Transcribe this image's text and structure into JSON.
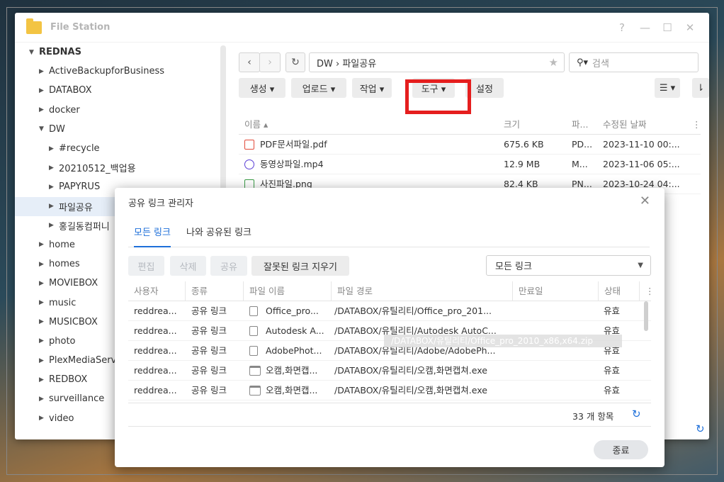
{
  "window": {
    "title": "File Station",
    "controls": [
      "?",
      "—",
      "☐",
      "✕"
    ]
  },
  "sidebar": {
    "root": "REDNAS",
    "items": [
      {
        "label": "ActiveBackupforBusiness",
        "level": 1,
        "expanded": false
      },
      {
        "label": "DATABOX",
        "level": 1,
        "expanded": false
      },
      {
        "label": "docker",
        "level": 1,
        "expanded": false
      },
      {
        "label": "DW",
        "level": 1,
        "expanded": true
      },
      {
        "label": "#recycle",
        "level": 2,
        "expanded": false
      },
      {
        "label": "20210512_백업용",
        "level": 2,
        "expanded": false
      },
      {
        "label": "PAPYRUS",
        "level": 2,
        "expanded": false
      },
      {
        "label": "파일공유",
        "level": 2,
        "expanded": false,
        "selected": true
      },
      {
        "label": "홍길동컴퍼니",
        "level": 2,
        "expanded": false
      },
      {
        "label": "home",
        "level": 1,
        "expanded": false
      },
      {
        "label": "homes",
        "level": 1,
        "expanded": false
      },
      {
        "label": "MOVIEBOX",
        "level": 1,
        "expanded": false
      },
      {
        "label": "music",
        "level": 1,
        "expanded": false
      },
      {
        "label": "MUSICBOX",
        "level": 1,
        "expanded": false
      },
      {
        "label": "photo",
        "level": 1,
        "expanded": false
      },
      {
        "label": "PlexMediaServer",
        "level": 1,
        "expanded": false
      },
      {
        "label": "REDBOX",
        "level": 1,
        "expanded": false
      },
      {
        "label": "surveillance",
        "level": 1,
        "expanded": false
      },
      {
        "label": "video",
        "level": 1,
        "expanded": false
      }
    ]
  },
  "nav": {
    "back": "‹",
    "forward": "›",
    "refresh": "↻",
    "path": "DW › 파일공유",
    "search_placeholder": "검색"
  },
  "toolbar": {
    "create": "생성 ▾",
    "upload": "업로드 ▾",
    "action": "작업 ▾",
    "tools": "도구 ▾",
    "settings": "설정"
  },
  "file_table": {
    "headers": {
      "name": "이름 ▴",
      "size": "크기",
      "type": "파...",
      "modified": "수정된 날짜",
      "more": "⋮"
    },
    "rows": [
      {
        "name": "PDF문서파일.pdf",
        "size": "675.6 KB",
        "type": "PD...",
        "modified": "2023-11-10 00:...",
        "icon": "pdf-icon",
        "color": "#e24b3b"
      },
      {
        "name": "동영상파일.mp4",
        "size": "12.9 MB",
        "type": "M...",
        "modified": "2023-11-06 05:...",
        "icon": "video-icon",
        "color": "#5a3fd6"
      },
      {
        "name": "사진파일.png",
        "size": "82.4 KB",
        "type": "PN...",
        "modified": "2023-10-24 04:...",
        "icon": "image-icon",
        "color": "#3b9d47"
      }
    ]
  },
  "dialog": {
    "title": "공유 링크 관리자",
    "tabs": [
      "모든 링크",
      "나와 공유된 링크"
    ],
    "buttons": {
      "edit": "편집",
      "delete": "삭제",
      "share": "공유",
      "clear_invalid": "잘못된 링크 지우기"
    },
    "filter": "모든 링크",
    "headers": {
      "user": "사용자",
      "kind": "종류",
      "file_name": "파일 이름",
      "file_path": "파일 경로",
      "expiry": "만료일",
      "status": "상태",
      "more": "⋮"
    },
    "rows": [
      {
        "user": "reddrea...",
        "kind": "공유 링크",
        "file_name": "Office_pro...",
        "file_path": "/DATABOX/유틸리티/Office_pro_201...",
        "expiry": "",
        "status": "유효",
        "icon": "zip-file-icon"
      },
      {
        "user": "reddrea...",
        "kind": "공유 링크",
        "file_name": "Autodesk A...",
        "file_path": "/DATABOX/유틸리티/Autodesk AutoC...",
        "expiry": "",
        "status": "유효",
        "icon": "zip-file-icon"
      },
      {
        "user": "reddrea...",
        "kind": "공유 링크",
        "file_name": "AdobePhot...",
        "file_path": "/DATABOX/유틸리티/Adobe/AdobePh...",
        "expiry": "",
        "status": "유효",
        "icon": "zip-file-icon"
      },
      {
        "user": "reddrea...",
        "kind": "공유 링크",
        "file_name": "오캠,화면캡...",
        "file_path": "/DATABOX/유틸리티/오캠,화면캡쳐.exe",
        "expiry": "",
        "status": "유효",
        "icon": "exe-file-icon"
      },
      {
        "user": "reddrea...",
        "kind": "공유 링크",
        "file_name": "오캠,화면캡...",
        "file_path": "/DATABOX/유틸리티/오캠,화면캡쳐.exe",
        "expiry": "",
        "status": "유효",
        "icon": "exe-file-icon"
      }
    ],
    "tooltip": "/DATABOX/유틸리티/Office_pro_2010_x86,x64.zip",
    "count": "33 개 항목",
    "close": "종료"
  },
  "colors": {
    "accent": "#1e6fd9",
    "highlight": "#e51e1e"
  }
}
